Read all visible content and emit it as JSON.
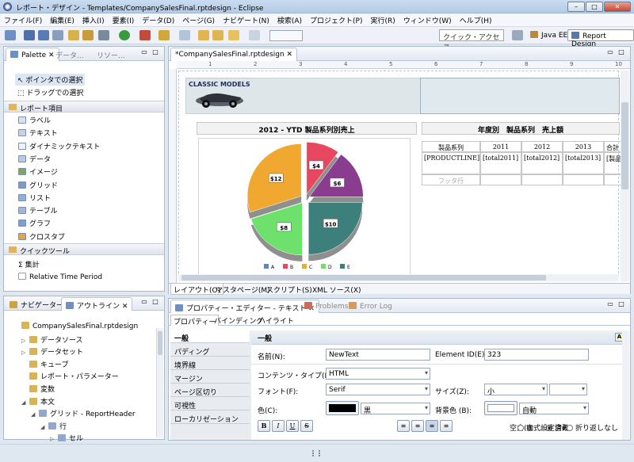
{
  "window": {
    "title": "レポート・デザイン - Templates/CompanySalesFinal.rptdesign - Eclipse"
  },
  "menu": [
    "ファイル(F)",
    "編集(E)",
    "挿入(I)",
    "要素(I)",
    "データ(D)",
    "ページ(G)",
    "ナビゲート(N)",
    "検索(A)",
    "プロジェクト(P)",
    "実行(R)",
    "ウィンドウ(W)",
    "ヘルプ(H)"
  ],
  "toolbar": {
    "quick_access_placeholder": "クイック・アクセス",
    "perspectives": [
      "Java EE",
      "Report Design"
    ]
  },
  "palette": {
    "tabs": [
      "Palette",
      "データ...",
      "リソー..."
    ],
    "selection": [
      "ポインタでの選択",
      "ドラッグでの選択"
    ],
    "report_items_title": "レポート項目",
    "report_items": [
      "ラベル",
      "テキスト",
      "ダイナミックテキスト",
      "データ",
      "イメージ",
      "グリッド",
      "リスト",
      "テーブル",
      "グラフ",
      "クロスタブ"
    ],
    "quick_tools_title": "クイックツール",
    "quick_tools": [
      "集計",
      "Relative Time Period"
    ]
  },
  "outline": {
    "tabs": [
      "ナビゲーター",
      "アウトライン"
    ],
    "tree": [
      "CompanySalesFinal.rptdesign",
      "データソース",
      "データセット",
      "キューブ",
      "レポート・パラメーター",
      "変数",
      "本文",
      "グリッド - ReportHeader",
      "行",
      "セル"
    ]
  },
  "editor": {
    "tab": "*CompanySalesFinal.rptdesign",
    "ruler_marks": [
      "1",
      "2",
      "3",
      "4",
      "5",
      "6",
      "7",
      "8",
      "9",
      "10"
    ],
    "logo_text": "CLASSIC MODELS",
    "chart_title": "2012 - YTD 製品系列別売上",
    "table_title": "年度別　製品系列　売上額",
    "table_headers": [
      "製品系列",
      "2011",
      "2012",
      "2013",
      "合計"
    ],
    "table_row": [
      "[PRODUCTLINE]",
      "[total2011]",
      "[total2012]",
      "[total2013]",
      "[製品系列計]"
    ],
    "footer_row": "フッタ行",
    "bottom_tabs": [
      "レイアウト(O)",
      "マスタページ(M)",
      "スクリプト(S)",
      "XML ソース(X)"
    ]
  },
  "chart_data": {
    "type": "pie",
    "title": "",
    "slices": [
      {
        "label": "A",
        "value": 10,
        "text": "$10",
        "color": "#3d7f7a"
      },
      {
        "label": "B",
        "value": 4,
        "text": "$4",
        "color": "#e8485f"
      },
      {
        "label": "C",
        "value": 12,
        "text": "$12",
        "color": "#f0a830"
      },
      {
        "label": "D",
        "value": 8,
        "text": "$8",
        "color": "#6ee06c"
      },
      {
        "label": "E",
        "value": 6,
        "text": "$6",
        "color": "#8a3c8e"
      }
    ],
    "legend": [
      "A",
      "B",
      "C",
      "D",
      "E"
    ],
    "legend_colors": [
      "#5f83c9",
      "#e8485f",
      "#f0a830",
      "#6ee06c",
      "#3d7f7a"
    ]
  },
  "props": {
    "tabs": [
      "プロパティー・エディター - テキスト",
      "Problems",
      "Error Log"
    ],
    "subtabs": [
      "プロパティー",
      "バインディング",
      "ハイライト"
    ],
    "sections": [
      "一般",
      "パディング",
      "境界線",
      "マージン",
      "ページ区切り",
      "可視性",
      "ローカリゼーション"
    ],
    "header": "一般",
    "name_label": "名前(N):",
    "name_value": "NewText",
    "id_label": "Element ID(E):",
    "id_value": "323",
    "content_type_label": "コンテンツ・タイプ(P):",
    "content_type_value": "HTML",
    "font_label": "フォント(F):",
    "font_value": "Serif",
    "size_label": "サイズ(Z):",
    "size_value": "小",
    "color_label": "色(C):",
    "color_value": "黒",
    "bg_label": "背景色 (B):",
    "bg_value": "自動",
    "whitespace_label": "空白(I):",
    "whitespace_options": [
      "自動",
      "書式設定済み",
      "折り返しなし"
    ],
    "format_buttons": [
      "B",
      "I",
      "U",
      "S"
    ]
  }
}
